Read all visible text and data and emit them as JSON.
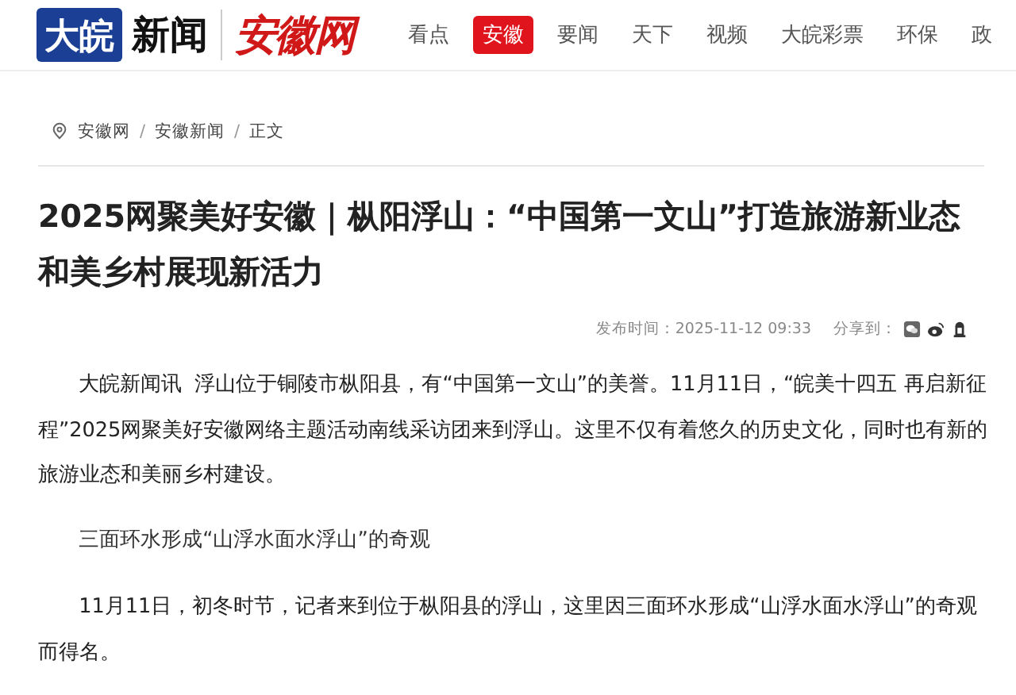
{
  "header": {
    "logo_box": "大皖",
    "logo_text": "新闻",
    "logo_script": "安徽网",
    "nav": [
      {
        "label": "看点",
        "selected": false
      },
      {
        "label": "安徽",
        "selected": true
      },
      {
        "label": "要闻",
        "selected": false
      },
      {
        "label": "天下",
        "selected": false
      },
      {
        "label": "视频",
        "selected": false
      },
      {
        "label": "大皖彩票",
        "selected": false
      },
      {
        "label": "环保",
        "selected": false
      },
      {
        "label": "政",
        "selected": false
      }
    ]
  },
  "breadcrumb": [
    "安徽网",
    "/",
    "安徽新闻",
    "/",
    "正文"
  ],
  "article": {
    "title": "2025网聚美好安徽｜枞阳浮山：“中国第一文山”打造旅游新业态和美乡村展现新活力",
    "published": "发布时间：2025-11-12 09:33",
    "share_label": "分享到：",
    "paragraphs": [
      {
        "kind": "body",
        "text": "大皖新闻讯  浮山位于铜陵市枞阳县，有“中国第一文山”的美誉。11月11日，“皖美十四五 再启新征程”2025网聚美好安徽网络主题活动南线采访团来到浮山。这里不仅有着悠久的历史文化，同时也有新的旅游业态和美丽乡村建设。"
      },
      {
        "kind": "subhead",
        "text": "三面环水形成“山浮水面水浮山”的奇观"
      },
      {
        "kind": "body",
        "text": "11月11日，初冬时节，记者来到位于枞阳县的浮山，这里因三面环水形成“山浮水面水浮山”的奇观而得名。"
      }
    ]
  }
}
